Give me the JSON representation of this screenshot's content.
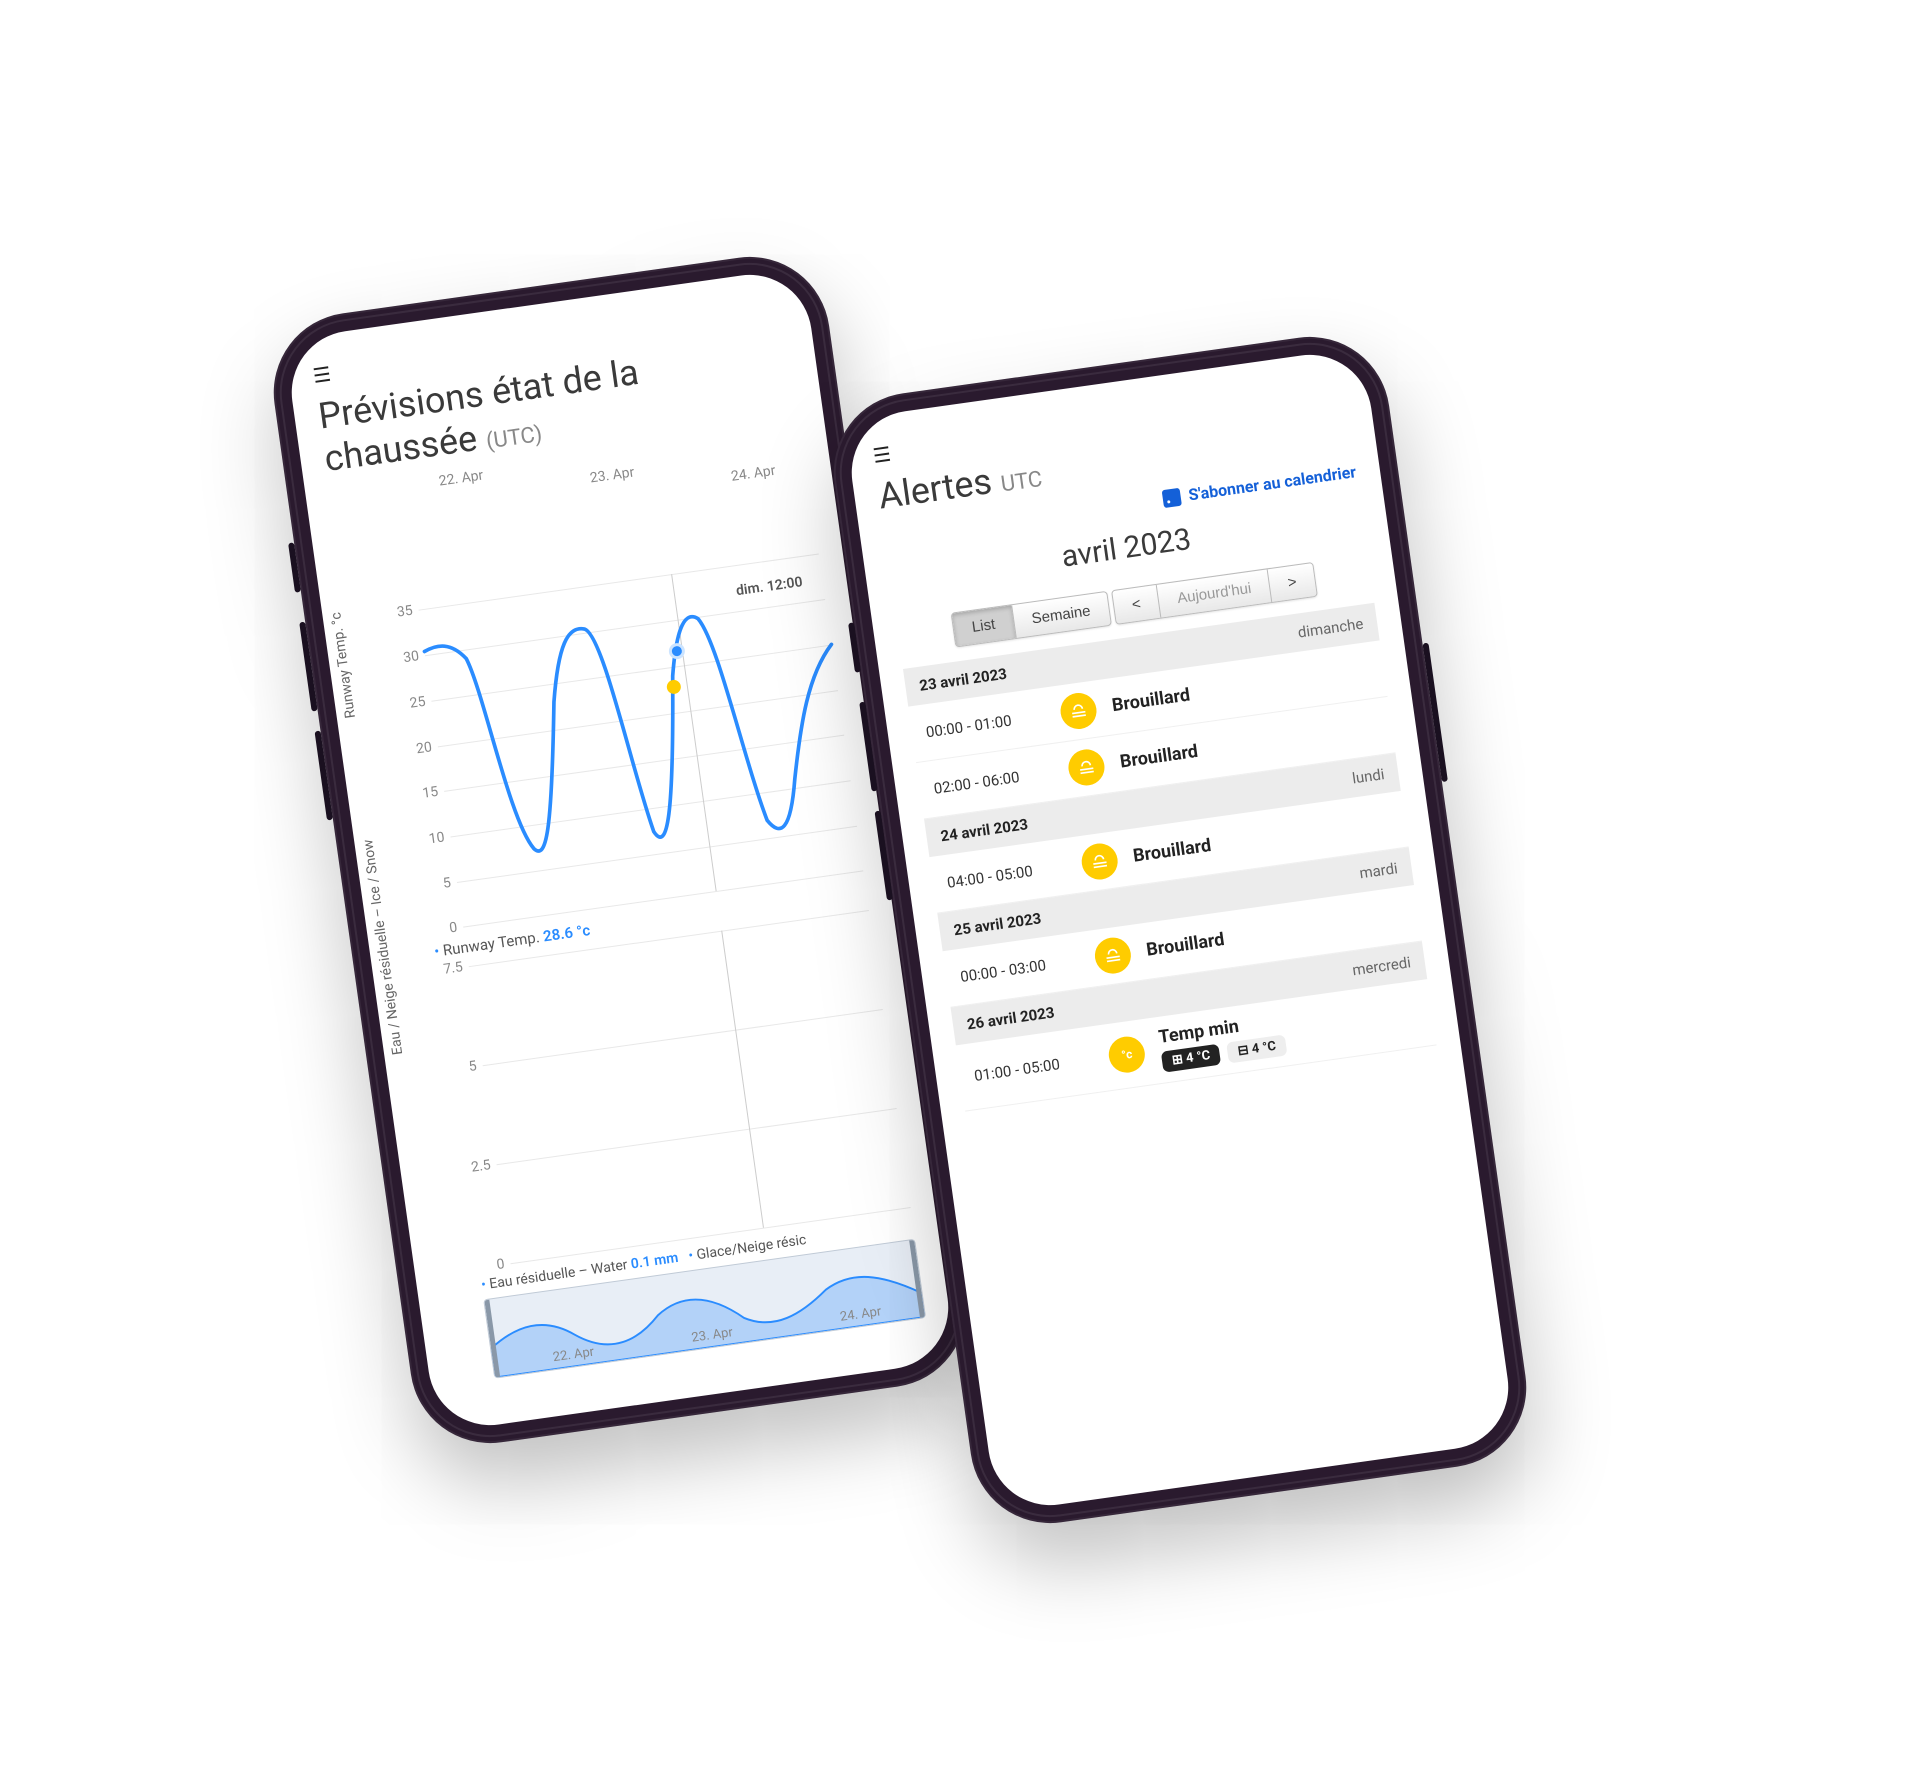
{
  "phone_left": {
    "title": "Prévisions état de la chaussée",
    "timezone": "(UTC)",
    "top_dates": [
      "22. Apr",
      "23. Apr",
      "24. Apr"
    ],
    "marker_label": "dim. 12:00",
    "chart1": {
      "y_label": "Runway Temp. °c",
      "y_ticks": [
        "35",
        "30",
        "25",
        "20",
        "15",
        "10",
        "5",
        "0"
      ]
    },
    "legend1_name": "Runway Temp.",
    "legend1_value": "28.6 °c",
    "chart2": {
      "y_label": "Eau / Neige résiduelle – Ice / Snow",
      "y_ticks": [
        "7.5",
        "5",
        "2.5",
        "0"
      ]
    },
    "legend2_a_name": "Eau résiduelle – Water",
    "legend2_a_value": "0.1 mm",
    "legend2_b_name": "Glace/Neige résic",
    "range_dates": [
      "22. Apr",
      "23. Apr",
      "24. Apr"
    ]
  },
  "phone_right": {
    "title": "Alertes",
    "timezone": "UTC",
    "subscribe_label": "S'abonner au calendrier",
    "calendar_month": "avril 2023",
    "seg_list": "List",
    "seg_week": "Semaine",
    "nav_prev": "<",
    "nav_today": "Aujourd'hui",
    "nav_next": ">",
    "days": [
      {
        "header": "23 avril 2023",
        "dow": "dimanche",
        "events": [
          {
            "time": "00:00 - 01:00",
            "icon": "fog",
            "label": "Brouillard"
          },
          {
            "time": "02:00 - 06:00",
            "icon": "fog",
            "label": "Brouillard"
          }
        ]
      },
      {
        "header": "24 avril 2023",
        "dow": "lundi",
        "events": [
          {
            "time": "04:00 - 05:00",
            "icon": "fog",
            "label": "Brouillard"
          }
        ]
      },
      {
        "header": "25 avril 2023",
        "dow": "mardi",
        "events": [
          {
            "time": "00:00 - 03:00",
            "icon": "fog",
            "label": "Brouillard"
          }
        ]
      },
      {
        "header": "26 avril 2023",
        "dow": "mercredi",
        "events": [
          {
            "time": "01:00 - 05:00",
            "icon": "temp",
            "label": "Temp min",
            "pill_dark": "4 °C",
            "pill_light": "4 °C"
          }
        ]
      }
    ]
  },
  "chart_data": [
    {
      "type": "line",
      "title": "Prévisions état de la chaussée (UTC)",
      "ylabel": "Runway Temp. °c",
      "ylim": [
        0,
        35
      ],
      "x_categories": [
        "22. Apr",
        "23. Apr",
        "24. Apr"
      ],
      "series": [
        {
          "name": "Runway Temp.",
          "y_approx": [
            30,
            28,
            12,
            5,
            7,
            22,
            30,
            28,
            12,
            5,
            8,
            26,
            30,
            26,
            12,
            6,
            5,
            12,
            20,
            24
          ],
          "current_marker": {
            "label": "dim. 12:00",
            "value": 28.6
          }
        }
      ]
    },
    {
      "type": "line",
      "ylabel": "Eau / Neige résiduelle – Ice / Snow",
      "ylim": [
        0,
        7.5
      ],
      "series": [
        {
          "name": "Eau résiduelle – Water",
          "current_value": 0.1,
          "unit": "mm"
        },
        {
          "name": "Glace/Neige résiduelle"
        }
      ]
    }
  ]
}
